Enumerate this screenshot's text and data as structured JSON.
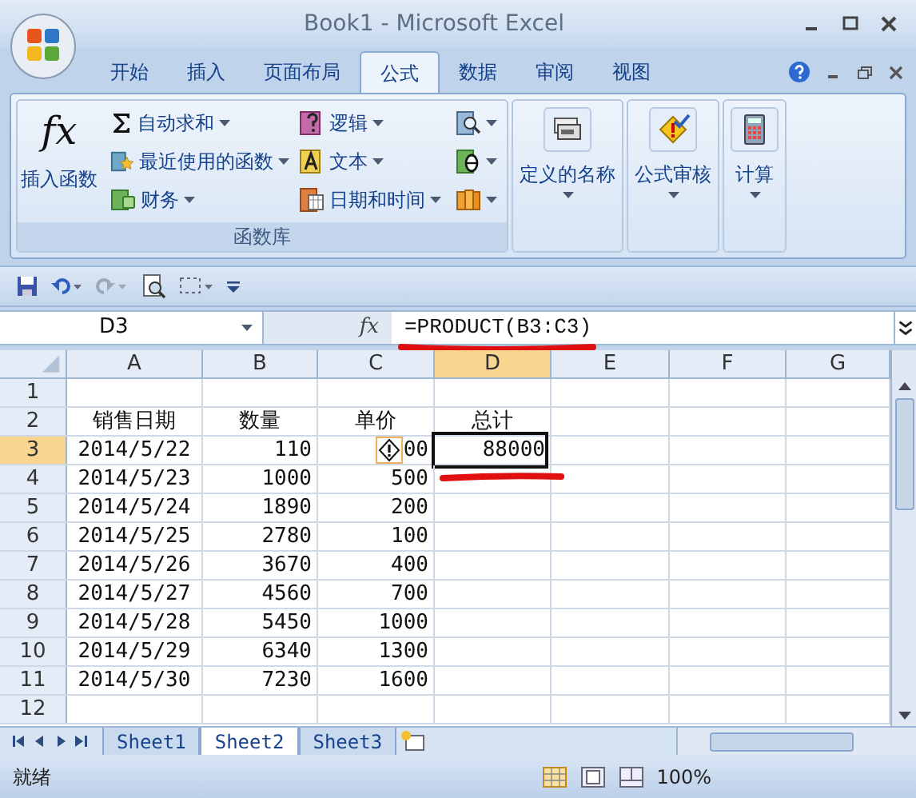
{
  "window": {
    "title": "Book1 - Microsoft Excel"
  },
  "tabs": [
    {
      "label": "开始",
      "selected": false
    },
    {
      "label": "插入",
      "selected": false
    },
    {
      "label": "页面布局",
      "selected": false
    },
    {
      "label": "公式",
      "selected": true
    },
    {
      "label": "数据",
      "selected": false
    },
    {
      "label": "审阅",
      "selected": false
    },
    {
      "label": "视图",
      "selected": false
    }
  ],
  "ribbon": {
    "function_library": {
      "label": "函数库",
      "insert_function": "插入函数",
      "insert_function_glyph": "fx",
      "columns": [
        [
          {
            "label": "自动求和",
            "kind": "sigma"
          },
          {
            "label": "最近使用的函数",
            "kind": "recent"
          },
          {
            "label": "财务",
            "kind": "finance"
          }
        ],
        [
          {
            "label": "逻辑",
            "kind": "logic"
          },
          {
            "label": "文本",
            "kind": "text"
          },
          {
            "label": "日期和时间",
            "kind": "date"
          }
        ],
        [
          {
            "kind": "lookup"
          },
          {
            "kind": "math"
          },
          {
            "kind": "more"
          }
        ]
      ]
    },
    "groups": [
      {
        "label": "定义的名称",
        "kind": "names"
      },
      {
        "label": "公式审核",
        "kind": "audit"
      },
      {
        "label": "计算",
        "kind": "calc"
      }
    ]
  },
  "formula_bar": {
    "name_box": "D3",
    "function_glyph": "fx",
    "formula": "=PRODUCT(B3:C3)"
  },
  "sheet": {
    "columns": [
      {
        "label": "A",
        "selected": false
      },
      {
        "label": "B",
        "selected": false
      },
      {
        "label": "C",
        "selected": false
      },
      {
        "label": "D",
        "selected": true
      },
      {
        "label": "E",
        "selected": false
      },
      {
        "label": "F",
        "selected": false
      },
      {
        "label": "G",
        "selected": false
      }
    ],
    "rows": [
      {
        "header": "1",
        "selected": false,
        "kind": "data",
        "cells": []
      },
      {
        "header": "2",
        "selected": false,
        "kind": "heading",
        "cells": [
          {
            "text": "销售日期"
          },
          {
            "text": "数量"
          },
          {
            "text": "单价"
          },
          {
            "text": "总计"
          }
        ]
      },
      {
        "header": "3",
        "selected": true,
        "kind": "data",
        "cells": [
          {
            "text": "2014/5/22"
          },
          {
            "text": "110"
          },
          {
            "text": "00",
            "warning": true
          },
          {
            "text": "88000",
            "selected": true
          }
        ]
      },
      {
        "header": "4",
        "selected": false,
        "kind": "data",
        "cells": [
          {
            "text": "2014/5/23"
          },
          {
            "text": "1000"
          },
          {
            "text": "500"
          }
        ]
      },
      {
        "header": "5",
        "selected": false,
        "kind": "data",
        "cells": [
          {
            "text": "2014/5/24"
          },
          {
            "text": "1890"
          },
          {
            "text": "200"
          }
        ]
      },
      {
        "header": "6",
        "selected": false,
        "kind": "data",
        "cells": [
          {
            "text": "2014/5/25"
          },
          {
            "text": "2780"
          },
          {
            "text": "100"
          }
        ]
      },
      {
        "header": "7",
        "selected": false,
        "kind": "data",
        "cells": [
          {
            "text": "2014/5/26"
          },
          {
            "text": "3670"
          },
          {
            "text": "400"
          }
        ]
      },
      {
        "header": "8",
        "selected": false,
        "kind": "data",
        "cells": [
          {
            "text": "2014/5/27"
          },
          {
            "text": "4560"
          },
          {
            "text": "700"
          }
        ]
      },
      {
        "header": "9",
        "selected": false,
        "kind": "data",
        "cells": [
          {
            "text": "2014/5/28"
          },
          {
            "text": "5450"
          },
          {
            "text": "1000"
          }
        ]
      },
      {
        "header": "10",
        "selected": false,
        "kind": "data",
        "cells": [
          {
            "text": "2014/5/29"
          },
          {
            "text": "6340"
          },
          {
            "text": "1300"
          }
        ]
      },
      {
        "header": "11",
        "selected": false,
        "kind": "data",
        "cells": [
          {
            "text": "2014/5/30"
          },
          {
            "text": "7230"
          },
          {
            "text": "1600"
          }
        ]
      },
      {
        "header": "12",
        "selected": false,
        "kind": "data",
        "cells": []
      }
    ]
  },
  "sheet_tabs": [
    {
      "label": "Sheet1",
      "selected": false
    },
    {
      "label": "Sheet2",
      "selected": true
    },
    {
      "label": "Sheet3",
      "selected": false
    }
  ],
  "status_bar": {
    "status": "就绪",
    "zoom": "100%"
  }
}
